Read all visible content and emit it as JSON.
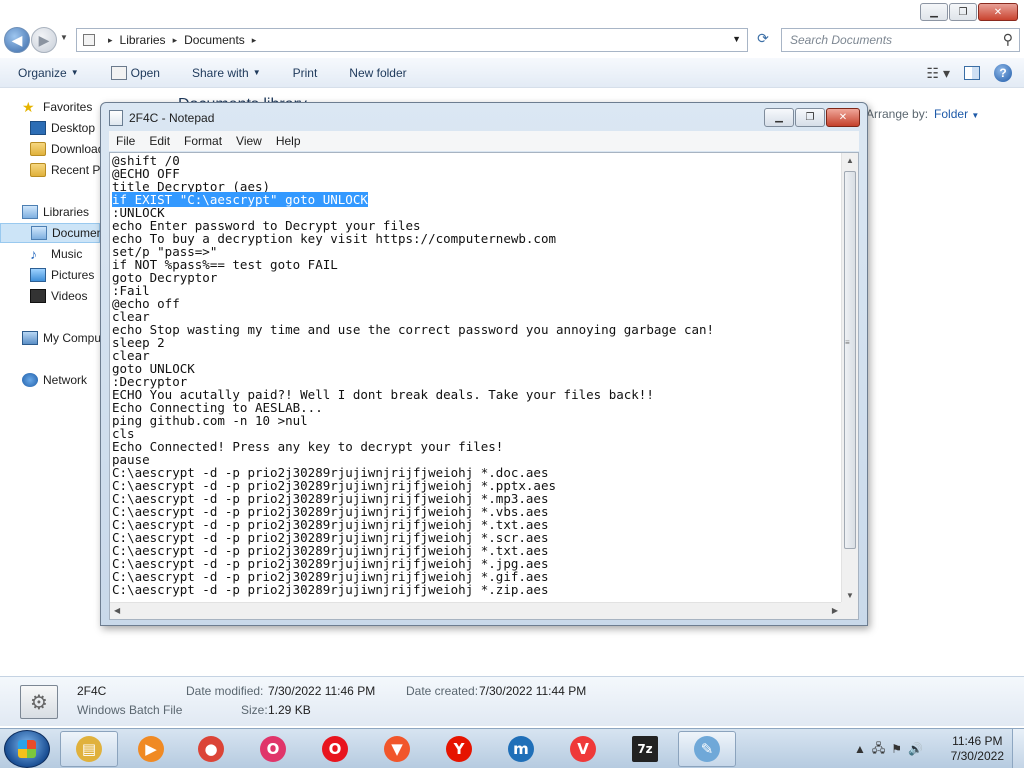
{
  "explorer": {
    "breadcrumb": [
      "Libraries",
      "Documents"
    ],
    "search_placeholder": "Search Documents",
    "toolbar": {
      "organize": "Organize",
      "open": "Open",
      "share_with": "Share with",
      "print": "Print",
      "new_folder": "New folder"
    },
    "arrange_by_label": "Arrange by:",
    "arrange_by_value": "Folder",
    "background_heading": "Documents library"
  },
  "navpane": {
    "favorites": "Favorites",
    "desktop": "Desktop",
    "downloads": "Downloads",
    "recent": "Recent Places",
    "libraries": "Libraries",
    "documents": "Documents",
    "music": "Music",
    "pictures": "Pictures",
    "videos": "Videos",
    "computer": "My Computer",
    "network": "Network"
  },
  "notepad": {
    "title": "2F4C - Notepad",
    "menu": [
      "File",
      "Edit",
      "Format",
      "View",
      "Help"
    ],
    "selected_line_index": 3,
    "lines": [
      "@shift /0",
      "@ECHO OFF",
      "title Decryptor (aes)",
      "if EXIST \"C:\\aescrypt\" goto UNLOCK",
      ":UNLOCK",
      "echo Enter password to Decrypt your files",
      "echo To buy a decryption key visit https://computernewb.com",
      "set/p \"pass=>\"",
      "if NOT %pass%== test goto FAIL",
      "goto Decryptor",
      ":Fail",
      "@echo off",
      "clear",
      "echo Stop wasting my time and use the correct password you annoying garbage can!",
      "sleep 2",
      "clear",
      "goto UNLOCK",
      ":Decryptor",
      "ECHO You acutally paid?! Well I dont break deals. Take your files back!!",
      "Echo Connecting to AESLAB...",
      "ping github.com -n 10 >nul",
      "cls",
      "Echo Connected! Press any key to decrypt your files!",
      "pause",
      "C:\\aescrypt -d -p prio2j30289rjujiwnjrijfjweiohj *.doc.aes",
      "C:\\aescrypt -d -p prio2j30289rjujiwnjrijfjweiohj *.pptx.aes",
      "C:\\aescrypt -d -p prio2j30289rjujiwnjrijfjweiohj *.mp3.aes",
      "C:\\aescrypt -d -p prio2j30289rjujiwnjrijfjweiohj *.vbs.aes",
      "C:\\aescrypt -d -p prio2j30289rjujiwnjrijfjweiohj *.txt.aes",
      "C:\\aescrypt -d -p prio2j30289rjujiwnjrijfjweiohj *.scr.aes",
      "C:\\aescrypt -d -p prio2j30289rjujiwnjrijfjweiohj *.txt.aes",
      "C:\\aescrypt -d -p prio2j30289rjujiwnjrijfjweiohj *.jpg.aes",
      "C:\\aescrypt -d -p prio2j30289rjujiwnjrijfjweiohj *.gif.aes",
      "C:\\aescrypt -d -p prio2j30289rjujiwnjrijfjweiohj *.zip.aes"
    ]
  },
  "details": {
    "file_name": "2F4C",
    "file_type": "Windows Batch File",
    "date_modified_label": "Date modified:",
    "date_modified": "7/30/2022 11:46 PM",
    "date_created_label": "Date created:",
    "date_created": "7/30/2022 11:44 PM",
    "size_label": "Size:",
    "size": "1.29 KB"
  },
  "taskbar": {
    "apps": [
      {
        "name": "explorer",
        "color": "#e0b13c",
        "glyph": "▤"
      },
      {
        "name": "media-player",
        "color": "#f08a24",
        "glyph": "▶"
      },
      {
        "name": "chrome",
        "color": "#db4437",
        "glyph": "●"
      },
      {
        "name": "opera-gx",
        "color": "#e0356a",
        "glyph": "O"
      },
      {
        "name": "opera",
        "color": "#e8141e",
        "glyph": "O"
      },
      {
        "name": "brave",
        "color": "#f1562b",
        "glyph": "▼"
      },
      {
        "name": "yandex",
        "color": "#e61400",
        "glyph": "Y"
      },
      {
        "name": "maxthon",
        "color": "#1f6fb8",
        "glyph": "m"
      },
      {
        "name": "vivaldi",
        "color": "#ef3939",
        "glyph": "V"
      },
      {
        "name": "7zip",
        "color": "#222222",
        "glyph": "7z"
      },
      {
        "name": "notepad",
        "color": "#6fa8d8",
        "glyph": "✎"
      }
    ],
    "clock_time": "11:46 PM",
    "clock_date": "7/30/2022"
  }
}
